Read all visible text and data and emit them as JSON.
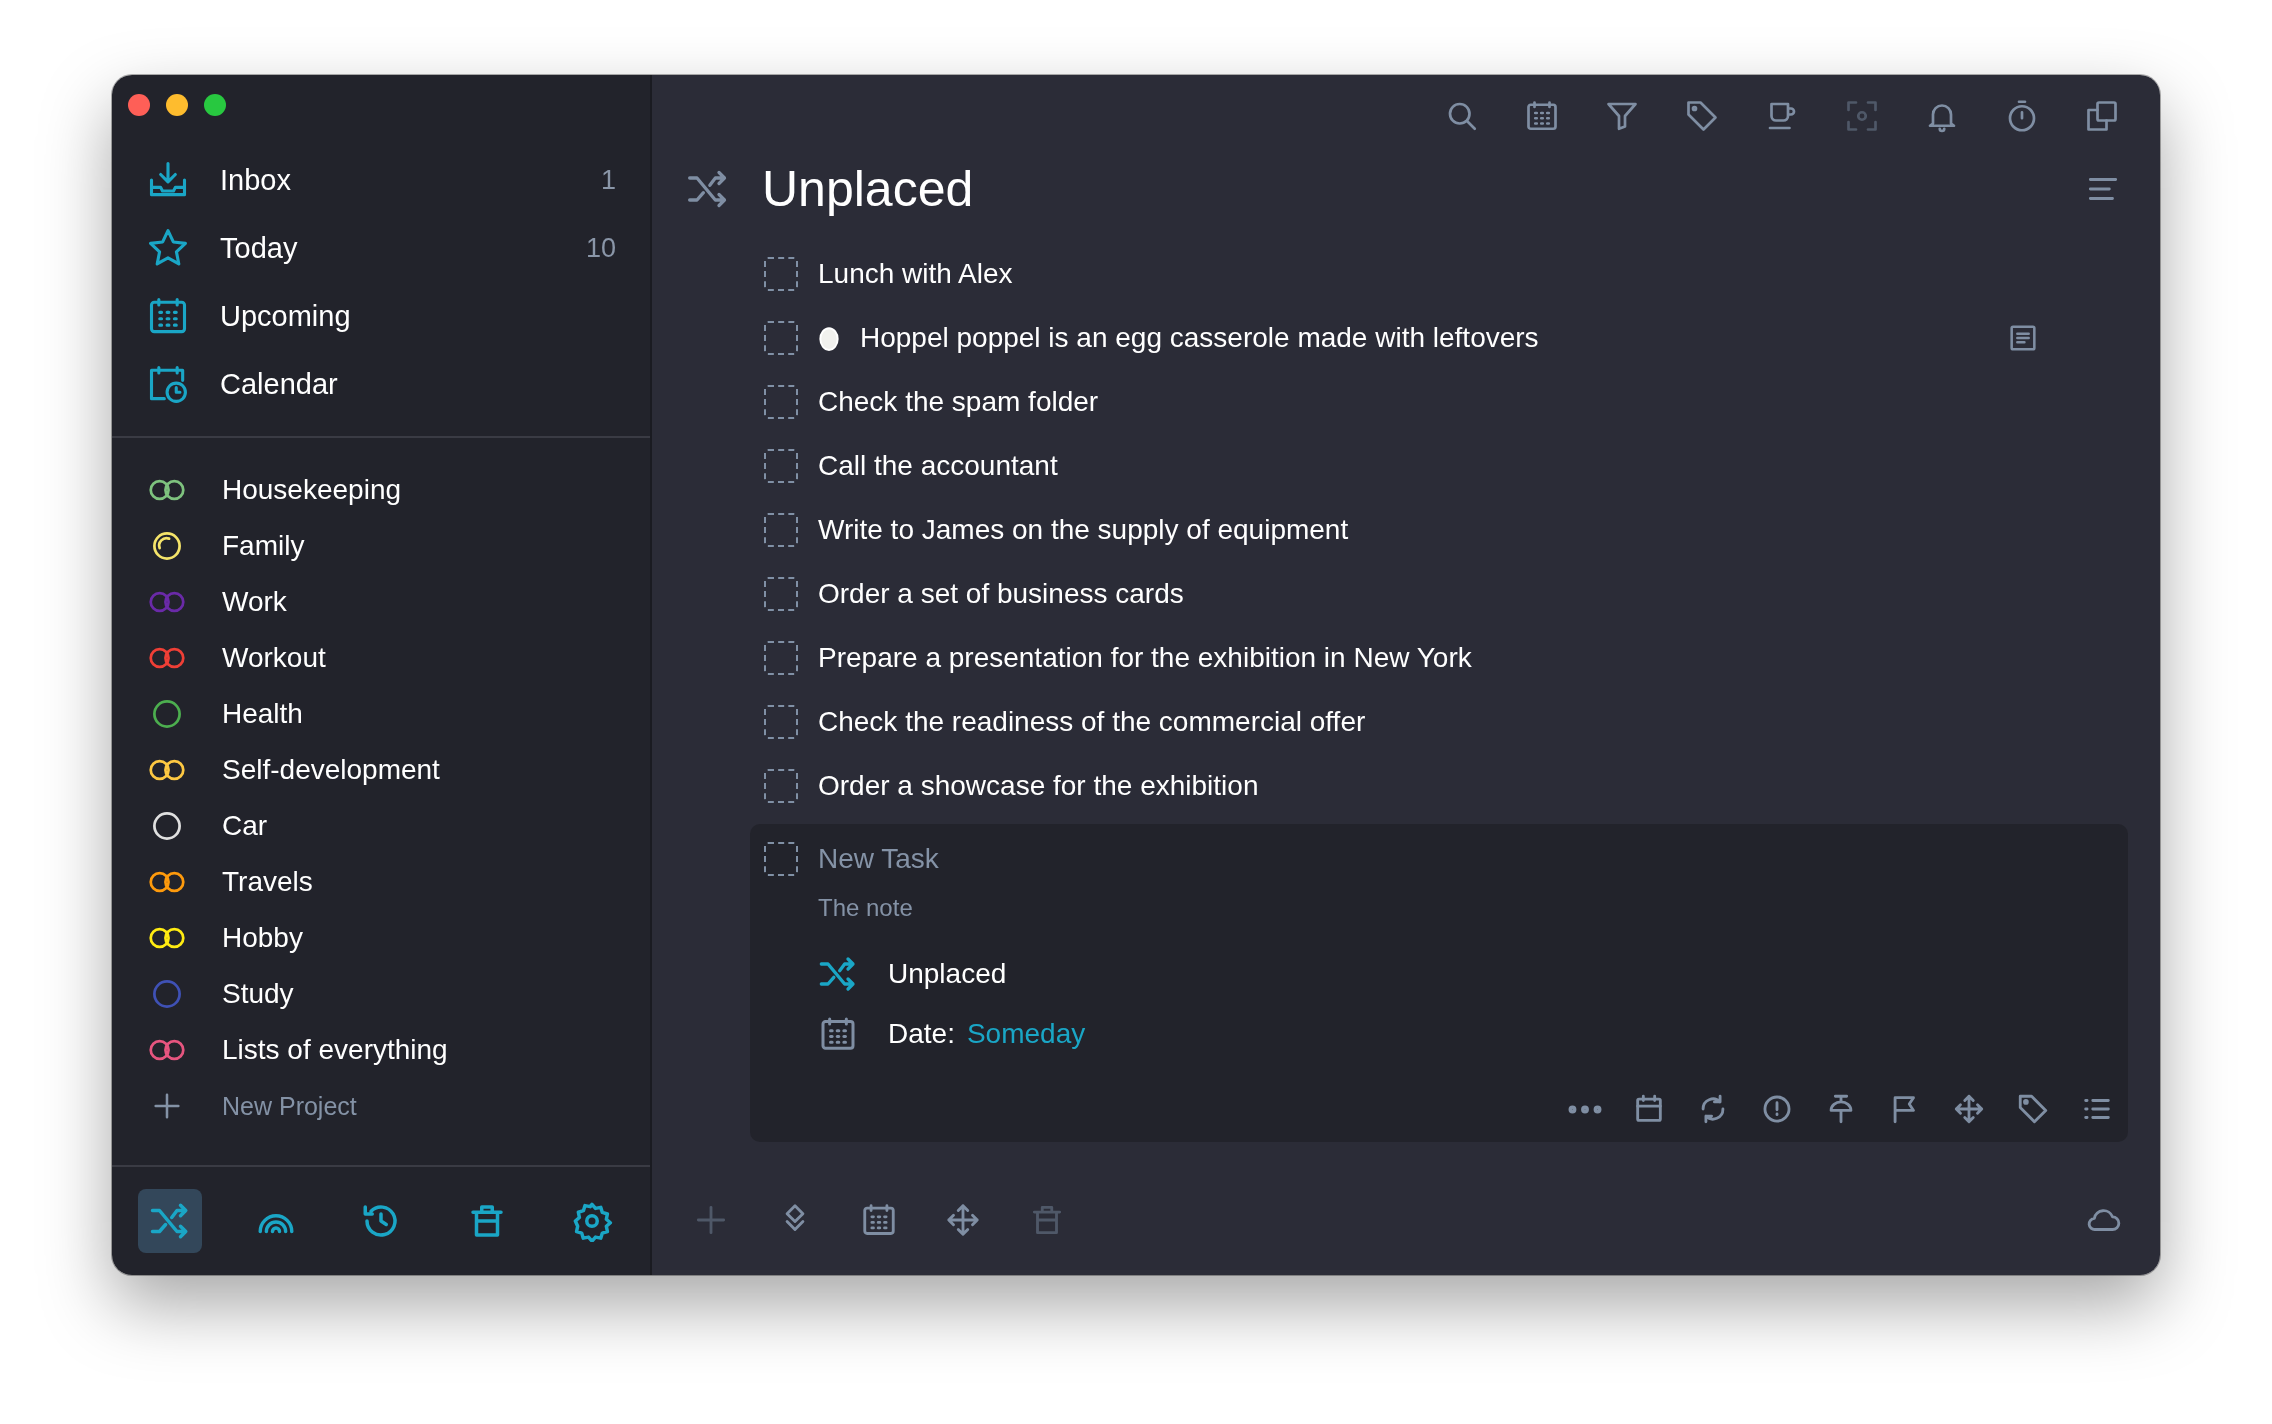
{
  "sidebar": {
    "nav": [
      {
        "kind": "inbox",
        "label": "Inbox",
        "count": "1"
      },
      {
        "kind": "star",
        "label": "Today",
        "count": "10"
      },
      {
        "kind": "calendar",
        "label": "Upcoming"
      },
      {
        "kind": "calclock",
        "label": "Calendar"
      }
    ],
    "projects": [
      {
        "kind": "linked",
        "name": "Housekeeping",
        "color": "#7ec27e"
      },
      {
        "kind": "partial",
        "name": "Family",
        "color": "#f5e46a"
      },
      {
        "kind": "linked",
        "name": "Work",
        "color": "#6a2aa8"
      },
      {
        "kind": "linked",
        "name": "Workout",
        "color": "#ef3f36"
      },
      {
        "kind": "circle",
        "name": "Health",
        "color": "#4cae4f"
      },
      {
        "kind": "linked",
        "name": "Self-development",
        "color": "#fdc842"
      },
      {
        "kind": "circle",
        "name": "Car",
        "color": "#e0e0e0"
      },
      {
        "kind": "linked",
        "name": "Travels",
        "color": "#fe9a0c"
      },
      {
        "kind": "linked",
        "name": "Hobby",
        "color": "#ffeb12"
      },
      {
        "kind": "circle",
        "name": "Study",
        "color": "#3f51b5"
      },
      {
        "kind": "linked",
        "name": "Lists of everything",
        "color": "#e6557f"
      }
    ],
    "new_project": "New Project",
    "tools": [
      {
        "kind": "shuffle",
        "selected": true
      },
      {
        "kind": "rainbow",
        "selected": false
      },
      {
        "kind": "history",
        "selected": false
      },
      {
        "kind": "trash",
        "selected": false
      },
      {
        "kind": "gear",
        "selected": false
      }
    ]
  },
  "toolbar": [
    {
      "kind": "search",
      "disabled": false
    },
    {
      "kind": "calendar",
      "disabled": false
    },
    {
      "kind": "filter",
      "disabled": false
    },
    {
      "kind": "tag",
      "disabled": false
    },
    {
      "kind": "cup",
      "disabled": false
    },
    {
      "kind": "focus",
      "disabled": true
    },
    {
      "kind": "bell",
      "disabled": false
    },
    {
      "kind": "timer",
      "disabled": false
    },
    {
      "kind": "copy",
      "disabled": false
    }
  ],
  "title": "Unplaced",
  "tasks": [
    {
      "title": "Lunch with Alex",
      "checked": false,
      "egg": false,
      "note": false
    },
    {
      "title": "Hoppel poppel is an egg casserole made with leftovers",
      "checked": false,
      "egg": true,
      "note": true
    },
    {
      "title": "Check the spam folder",
      "checked": false,
      "egg": false,
      "note": false
    },
    {
      "title": "Call the accountant",
      "checked": false,
      "egg": false,
      "note": false
    },
    {
      "title": "Write to James on the supply of equipment",
      "checked": false,
      "egg": false,
      "note": false
    },
    {
      "title": "Order a set of business cards",
      "checked": false,
      "egg": false,
      "note": false
    },
    {
      "title": "Prepare a presentation for the exhibition in New York",
      "checked": false,
      "egg": false,
      "note": false
    },
    {
      "title": "Check the readiness of the commercial offer",
      "checked": false,
      "egg": false,
      "note": false
    },
    {
      "title": "Order a showcase for the exhibition",
      "checked": false,
      "egg": false,
      "note": false
    }
  ],
  "editor": {
    "checked": false,
    "placeholder": "New Task",
    "note_placeholder": "The note",
    "project": "Unplaced",
    "date_label": "Date:",
    "date_value": "Someday"
  },
  "bottom": [
    {
      "kind": "plus",
      "disabled": true
    },
    {
      "kind": "layers",
      "disabled": false
    },
    {
      "kind": "calendar",
      "disabled": false
    },
    {
      "kind": "move",
      "disabled": false
    },
    {
      "kind": "trash",
      "disabled": true
    }
  ]
}
